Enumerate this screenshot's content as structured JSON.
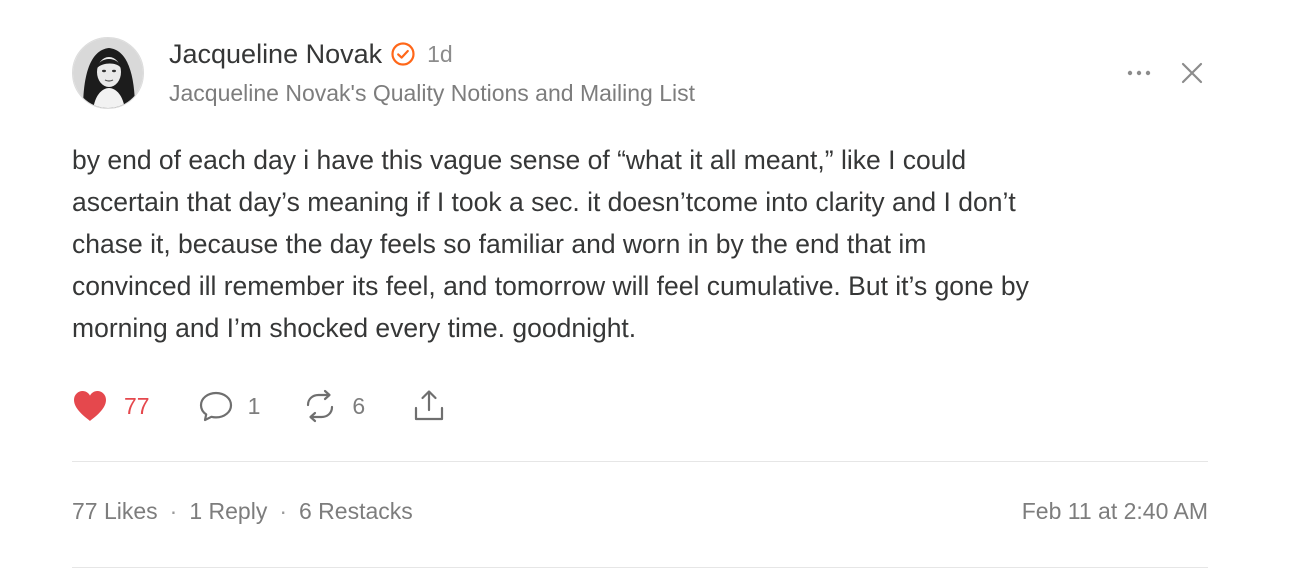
{
  "author": {
    "name": "Jacqueline Novak",
    "verified": true,
    "time_ago": "1d",
    "publication": "Jacqueline Novak's Quality Notions and Mailing List"
  },
  "post": {
    "lines": [
      "by end of each day i have this vague sense of “what it all meant,” like I could",
      "ascertain that day’s meaning if I took a sec. it doesn’tcome into clarity and I don’t",
      "chase it, because the day feels so familiar and worn in by the end that im",
      "convinced ill remember its feel, and tomorrow will feel cumulative. But it’s gone by",
      "morning and I’m shocked every time. goodnight."
    ]
  },
  "actions": {
    "likes": "77",
    "replies": "1",
    "restacks": "6",
    "liked": true
  },
  "stats": {
    "likes_label": "77 Likes",
    "replies_label": "1 Reply",
    "restacks_label": "6 Restacks",
    "separator": "·",
    "posted_at": "Feb 11 at 2:40 AM"
  },
  "icons": {
    "verified": "verified-check-icon",
    "more": "more-horizontal-icon",
    "close": "close-icon",
    "like": "heart-icon",
    "reply": "comment-icon",
    "restack": "restack-icon",
    "share": "share-icon"
  },
  "colors": {
    "accent_orange": "#ff6719",
    "like_red": "#e5484d",
    "text": "#363737",
    "muted": "#7d7d7d",
    "divider": "#e6e6e6"
  }
}
